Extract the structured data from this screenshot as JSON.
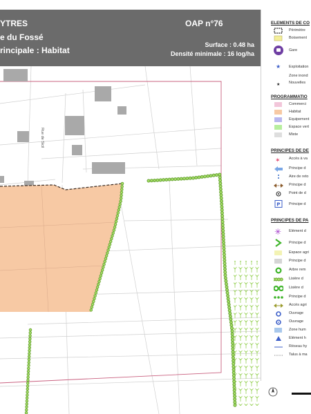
{
  "header": {
    "commune": "YTRES",
    "site_name": "e du Fossé",
    "vocation": "rincipale : Habitat",
    "oap_number": "OAP n°76",
    "surface": "Surface : 0.48 ha",
    "density": "Densité minimale : 16 log/ha"
  },
  "map": {
    "street_label": "Rue de Sicil",
    "colors": {
      "habitat_zone": "#f7c9a4",
      "hedge_green": "#8fd14f",
      "header_bg": "#6b6b6b",
      "perimeter_pink": "#c9607f",
      "building_gray": "#a9a9a9",
      "orchard_green": "#8fd14f"
    }
  },
  "legend": {
    "sections": [
      {
        "title": "ELEMENTS DE CO",
        "items": [
          {
            "label": "Périmètre",
            "symbol": "dashed-rect"
          },
          {
            "label": "Boisement",
            "symbol": "yellow-rect"
          },
          {
            "label": "Gare",
            "symbol": "train-circle"
          },
          {
            "label": "Exploitation",
            "symbol": "blue-star"
          },
          {
            "label": "Zone inond",
            "symbol": "blank"
          },
          {
            "label": "Nouvelles",
            "symbol": "black-star"
          }
        ]
      },
      {
        "title": "PROGRAMMATIO",
        "items": [
          {
            "label": "Commerci",
            "symbol": "pink-rect"
          },
          {
            "label": "Habitat",
            "symbol": "peach-rect"
          },
          {
            "label": "Equipement",
            "symbol": "violet-rect"
          },
          {
            "label": "Espace vert",
            "symbol": "green-rect"
          },
          {
            "label": "Mixte",
            "symbol": "gray-rect"
          }
        ]
      },
      {
        "title": "PRINCIPES DE DE",
        "items": [
          {
            "label": "Accès à va",
            "symbol": "red-star"
          },
          {
            "label": "Principe d",
            "symbol": "blue-arrow"
          },
          {
            "label": "Aire de reto",
            "symbol": "blue-dash"
          },
          {
            "label": "Principe d",
            "symbol": "brown-double-arrow"
          },
          {
            "label": "Point de d",
            "symbol": "dot-circle"
          },
          {
            "label": "Principe d",
            "symbol": "parking-p"
          }
        ]
      },
      {
        "title": "PRINCIPES DE PA",
        "items": [
          {
            "label": "Elément d",
            "symbol": "purple-asterisk"
          },
          {
            "label": "Principe d",
            "symbol": "green-chevron"
          },
          {
            "label": "Espace agri",
            "symbol": "lightyellow-rect"
          },
          {
            "label": "Principe d",
            "symbol": "lightgray-rect"
          },
          {
            "label": "Arbre rem",
            "symbol": "green-ring"
          },
          {
            "label": "Lisière d",
            "symbol": "hedge-band"
          },
          {
            "label": "Lisière d",
            "symbol": "double-ring"
          },
          {
            "label": "Principe d",
            "symbol": "dots-line"
          },
          {
            "label": "Accès agri",
            "symbol": "olive-arrow"
          },
          {
            "label": "Ouvrage",
            "symbol": "blue-ring"
          },
          {
            "label": "Ouvrage",
            "symbol": "blue-ring-2"
          },
          {
            "label": "Zone hum",
            "symbol": "lightblue-rect"
          },
          {
            "label": "Elément h",
            "symbol": "blue-triangle"
          },
          {
            "label": "Réseau hy",
            "symbol": "blue-line"
          },
          {
            "label": "Talus à ma",
            "symbol": "dotted-line"
          }
        ]
      }
    ]
  }
}
